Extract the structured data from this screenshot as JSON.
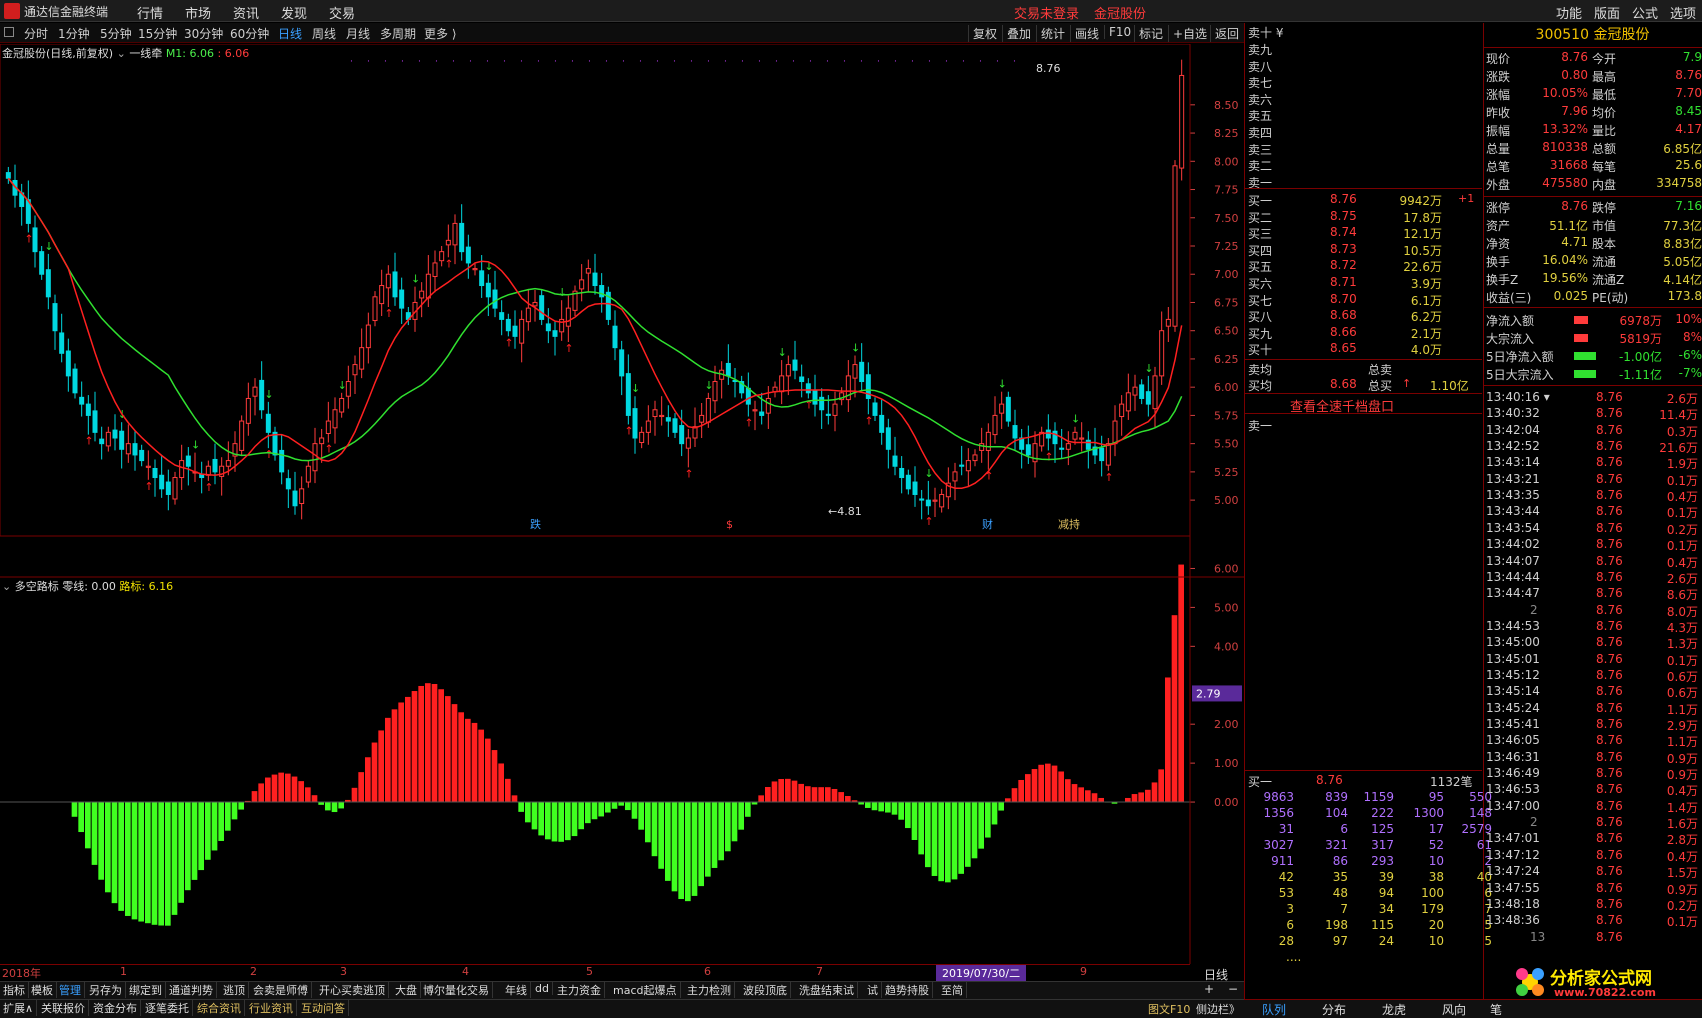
{
  "app": {
    "title": "通达信金融终端"
  },
  "menu": [
    "行情",
    "市场",
    "资讯",
    "发现",
    "交易"
  ],
  "trade_status": {
    "not_logged": "交易未登录",
    "stock": "金冠股份"
  },
  "right_menu": [
    "功能",
    "版面",
    "公式",
    "选项"
  ],
  "toolbar": {
    "periods": [
      "分时",
      "1分钟",
      "5分钟",
      "15分钟",
      "30分钟",
      "60分钟",
      "日线",
      "周线",
      "月线",
      "多周期",
      "更多 ⟩"
    ],
    "active_period": "日线",
    "right": [
      "复权",
      "叠加",
      "统计",
      "画线",
      "F10",
      "标记",
      "+自选",
      "返回"
    ]
  },
  "main_chart": {
    "label": "金冠股份(日线,前复权)",
    "indicator": "一线牵",
    "m1_label": "M1: 6.06",
    "m1_value": "6.06",
    "high_label": "8.76",
    "low_label": "←4.81",
    "yticks": [
      "8.50",
      "8.25",
      "8.00",
      "7.75",
      "7.50",
      "7.25",
      "7.00",
      "6.75",
      "6.50",
      "6.25",
      "6.00",
      "5.75",
      "5.50",
      "5.25",
      "5.00"
    ],
    "markers": [
      "跌",
      "$",
      "财",
      "减持"
    ]
  },
  "sub_chart": {
    "name": "多空路标",
    "zero_label": "零线: 0.00",
    "road_label": "路标: 6.16",
    "yticks": [
      "6.00",
      "5.00",
      "4.00",
      "2.00",
      "1.00",
      "0.00"
    ],
    "current": "2.79",
    "period_label": "日线"
  },
  "xaxis": {
    "labels": [
      "2018年",
      "1",
      "2",
      "3",
      "4",
      "5",
      "6",
      "7",
      "9"
    ],
    "date_flag": "2019/07/30/二"
  },
  "bottom_tabs": [
    "指标",
    "模板",
    "管理",
    "另存为",
    "绑定到",
    "通道判势",
    "逃顶",
    "会卖是师傅",
    "开心买卖逃顶",
    "大盘",
    "博尔量化交易",
    "年线",
    "dd",
    "主力资金",
    "macd起爆点",
    "主力检测",
    "波段顶底",
    "洗盘结束试",
    "试",
    "趋势持股",
    "至简"
  ],
  "bottom_tabs_active": "管理",
  "bottom_tabs2": [
    "扩展∧",
    "关联报价",
    "资金分布",
    "逐笔委托",
    "综合资讯",
    "行业资讯",
    "互动问答"
  ],
  "right_tail": [
    "图文F10",
    "侧边栏》"
  ],
  "quote": {
    "header": "卖十 ¥",
    "sells": [
      "卖九",
      "卖八",
      "卖七",
      "卖六",
      "卖五",
      "卖四",
      "卖三",
      "卖二",
      "卖一"
    ],
    "buys": [
      {
        "label": "买一",
        "price": "8.76",
        "vol": "9942万",
        "chg": "+1"
      },
      {
        "label": "买二",
        "price": "8.75",
        "vol": "17.8万",
        "chg": ""
      },
      {
        "label": "买三",
        "price": "8.74",
        "vol": "12.1万",
        "chg": ""
      },
      {
        "label": "买四",
        "price": "8.73",
        "vol": "10.5万",
        "chg": ""
      },
      {
        "label": "买五",
        "price": "8.72",
        "vol": "22.6万",
        "chg": ""
      },
      {
        "label": "买六",
        "price": "8.71",
        "vol": "3.9万",
        "chg": ""
      },
      {
        "label": "买七",
        "price": "8.70",
        "vol": "6.1万",
        "chg": ""
      },
      {
        "label": "买八",
        "price": "8.68",
        "vol": "6.2万",
        "chg": ""
      },
      {
        "label": "买九",
        "price": "8.66",
        "vol": "2.1万",
        "chg": ""
      },
      {
        "label": "买十",
        "price": "8.65",
        "vol": "4.0万",
        "chg": ""
      }
    ],
    "avg_sell": "卖均",
    "total_sell": "总卖",
    "avg_buy": "买均",
    "avg_buy_price": "8.68",
    "total_buy": "总买",
    "total_buy_val": "1.10亿",
    "link": "查看全速千档盘口",
    "sell1": "卖一",
    "buy1_summary": {
      "label": "买一",
      "price": "8.76",
      "count": "1132笔"
    },
    "queue": [
      [
        "9863",
        "839",
        "1159",
        "95",
        "550"
      ],
      [
        "1356",
        "104",
        "222",
        "1300",
        "148"
      ],
      [
        "31",
        "6",
        "125",
        "17",
        "2579"
      ],
      [
        "3027",
        "321",
        "317",
        "52",
        "61"
      ],
      [
        "911",
        "86",
        "293",
        "10",
        "2"
      ],
      [
        "42",
        "35",
        "39",
        "38",
        "40"
      ],
      [
        "53",
        "48",
        "94",
        "100",
        "6"
      ],
      [
        "3",
        "7",
        "34",
        "179",
        "7"
      ],
      [
        "6",
        "198",
        "115",
        "20",
        "5"
      ],
      [
        "28",
        "97",
        "24",
        "10",
        "5"
      ]
    ],
    "more": "...."
  },
  "info": {
    "header": "300510 金冠股份",
    "rows": [
      [
        "现价",
        "8.76",
        "今开",
        "7.9"
      ],
      [
        "涨跌",
        "0.80",
        "最高",
        "8.76"
      ],
      [
        "涨幅",
        "10.05%",
        "最低",
        "7.70"
      ],
      [
        "昨收",
        "7.96",
        "均价",
        "8.45"
      ],
      [
        "振幅",
        "13.32%",
        "量比",
        "4.17"
      ],
      [
        "总量",
        "810338",
        "总额",
        "6.85亿"
      ],
      [
        "总笔",
        "31668",
        "每笔",
        "25.6"
      ],
      [
        "外盘",
        "475580",
        "内盘",
        "334758"
      ]
    ],
    "rows2": [
      [
        "涨停",
        "8.76",
        "跌停",
        "7.16"
      ],
      [
        "资产",
        "51.1亿",
        "市值",
        "77.3亿"
      ],
      [
        "净资",
        "4.71",
        "股本",
        "8.83亿"
      ],
      [
        "换手",
        "16.04%",
        "流通",
        "5.05亿"
      ],
      [
        "换手Z",
        "19.56%",
        "流通Z",
        "4.14亿"
      ],
      [
        "收益(三)",
        "0.025",
        "PE(动)",
        "173.8"
      ]
    ],
    "flows": [
      [
        "净流入额",
        "6978万",
        "10%"
      ],
      [
        "大宗流入",
        "5819万",
        "8%"
      ],
      [
        "5日净流入额",
        "-1.00亿",
        "-6%"
      ],
      [
        "5日大宗流入",
        "-1.11亿",
        "-7%"
      ]
    ],
    "ticks": [
      [
        "13:40:16 ▾",
        "8.76",
        "2.6万"
      ],
      [
        "13:40:32",
        "8.76",
        "11.4万"
      ],
      [
        "13:42:04",
        "8.76",
        "0.3万"
      ],
      [
        "13:42:52",
        "8.76",
        "21.6万"
      ],
      [
        "13:43:14",
        "8.76",
        "1.9万"
      ],
      [
        "13:43:21",
        "8.76",
        "0.1万"
      ],
      [
        "13:43:35",
        "8.76",
        "0.4万"
      ],
      [
        "13:43:44",
        "8.76",
        "0.1万"
      ],
      [
        "13:43:54",
        "8.76",
        "0.2万"
      ],
      [
        "13:44:02",
        "8.76",
        "0.1万"
      ],
      [
        "13:44:07",
        "8.76",
        "0.4万"
      ],
      [
        "13:44:44",
        "8.76",
        "2.6万"
      ],
      [
        "13:44:47",
        "8.76",
        "8.6万"
      ],
      [
        "2",
        "8.76",
        "8.0万"
      ],
      [
        "13:44:53",
        "8.76",
        "4.3万"
      ],
      [
        "13:45:00",
        "8.76",
        "1.3万"
      ],
      [
        "13:45:01",
        "8.76",
        "0.1万"
      ],
      [
        "13:45:12",
        "8.76",
        "0.6万"
      ],
      [
        "13:45:14",
        "8.76",
        "0.6万"
      ],
      [
        "13:45:24",
        "8.76",
        "1.1万"
      ],
      [
        "13:45:41",
        "8.76",
        "2.9万"
      ],
      [
        "13:46:05",
        "8.76",
        "1.1万"
      ],
      [
        "13:46:31",
        "8.76",
        "0.9万"
      ],
      [
        "13:46:49",
        "8.76",
        "0.9万"
      ],
      [
        "13:46:53",
        "8.76",
        "0.4万"
      ],
      [
        "13:47:00",
        "8.76",
        "1.4万"
      ],
      [
        "2",
        "8.76",
        "1.6万"
      ],
      [
        "13:47:01",
        "8.76",
        "2.8万"
      ],
      [
        "13:47:12",
        "8.76",
        "0.4万"
      ],
      [
        "13:47:24",
        "8.76",
        "1.5万"
      ],
      [
        "13:47:55",
        "8.76",
        "0.9万"
      ],
      [
        "13:48:18",
        "8.76",
        "0.2万"
      ],
      [
        "13:48:36",
        "8.76",
        "0.1万"
      ],
      [
        "13",
        "8.76",
        ""
      ]
    ]
  },
  "right_tabs": [
    "队列",
    "分布",
    "龙虎",
    "风向",
    "笔"
  ],
  "right_tabs_active": "队列",
  "watermark": {
    "text": "分析家公式网",
    "url": "www.70822.com"
  },
  "colors": {
    "up": "#ff3b3b",
    "down": "#30e030",
    "ma_slow": "#30e030",
    "ma_fast": "#ff2020",
    "cyan": "#00d8e0"
  }
}
